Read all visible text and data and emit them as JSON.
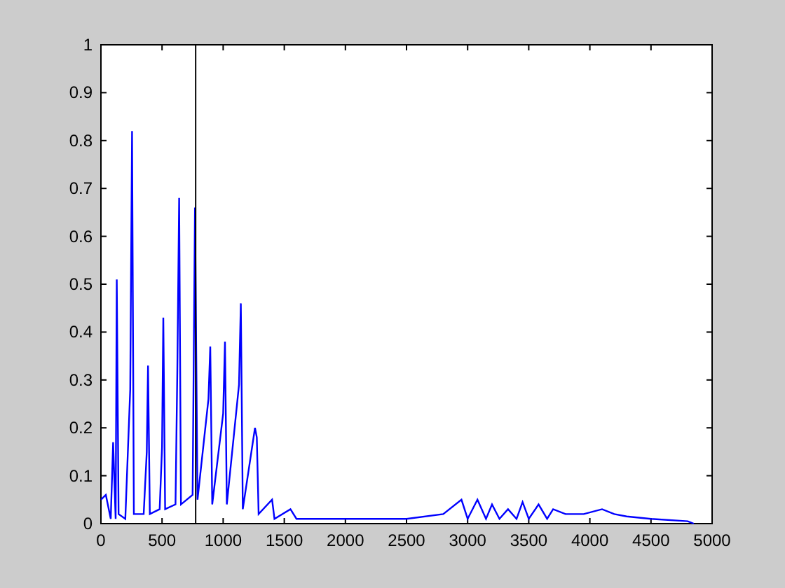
{
  "figure": {
    "chart_data": {
      "type": "line",
      "x": [
        0,
        40,
        80,
        100,
        120,
        130,
        145,
        200,
        240,
        255,
        270,
        350,
        375,
        385,
        400,
        480,
        500,
        510,
        525,
        610,
        625,
        640,
        655,
        750,
        770,
        790,
        880,
        895,
        910,
        1000,
        1015,
        1030,
        1130,
        1145,
        1160,
        1260,
        1275,
        1290,
        1400,
        1420,
        1550,
        1600,
        2000,
        2500,
        2800,
        2950,
        3000,
        3080,
        3150,
        3200,
        3260,
        3330,
        3400,
        3450,
        3500,
        3580,
        3650,
        3700,
        3800,
        3950,
        4100,
        4200,
        4300,
        4500,
        4800,
        4850
      ],
      "series": [
        {
          "color": "#0000ff",
          "values": [
            0.05,
            0.06,
            0.01,
            0.17,
            0.01,
            0.51,
            0.02,
            0.01,
            0.28,
            0.82,
            0.02,
            0.02,
            0.15,
            0.33,
            0.02,
            0.03,
            0.16,
            0.43,
            0.03,
            0.04,
            0.32,
            0.68,
            0.04,
            0.06,
            0.66,
            0.05,
            0.26,
            0.37,
            0.04,
            0.23,
            0.38,
            0.04,
            0.29,
            0.46,
            0.03,
            0.2,
            0.18,
            0.02,
            0.05,
            0.01,
            0.03,
            0.01,
            0.01,
            0.01,
            0.02,
            0.05,
            0.01,
            0.05,
            0.01,
            0.04,
            0.01,
            0.03,
            0.01,
            0.045,
            0.01,
            0.04,
            0.01,
            0.03,
            0.02,
            0.02,
            0.03,
            0.02,
            0.015,
            0.01,
            0.005,
            0
          ]
        }
      ],
      "ref_lines": [
        {
          "axis": "x",
          "value": 775,
          "color": "#000000"
        }
      ],
      "xlim": [
        0,
        5000
      ],
      "ylim": [
        0,
        1
      ],
      "xticks": [
        0,
        500,
        1000,
        1500,
        2000,
        2500,
        3000,
        3500,
        4000,
        4500,
        5000
      ],
      "yticks": [
        {
          "value": 0,
          "label": "0"
        },
        {
          "value": 0.1,
          "label": "0.1"
        },
        {
          "value": 0.2,
          "label": "0.2"
        },
        {
          "value": 0.3,
          "label": "0.3"
        },
        {
          "value": 0.4,
          "label": "0.4"
        },
        {
          "value": 0.5,
          "label": "0.5"
        },
        {
          "value": 0.6,
          "label": "0.6"
        },
        {
          "value": 0.7,
          "label": "0.7"
        },
        {
          "value": 0.8,
          "label": "0.8"
        },
        {
          "value": 0.9,
          "label": "0.9"
        },
        {
          "value": 1,
          "label": "1"
        }
      ]
    }
  }
}
